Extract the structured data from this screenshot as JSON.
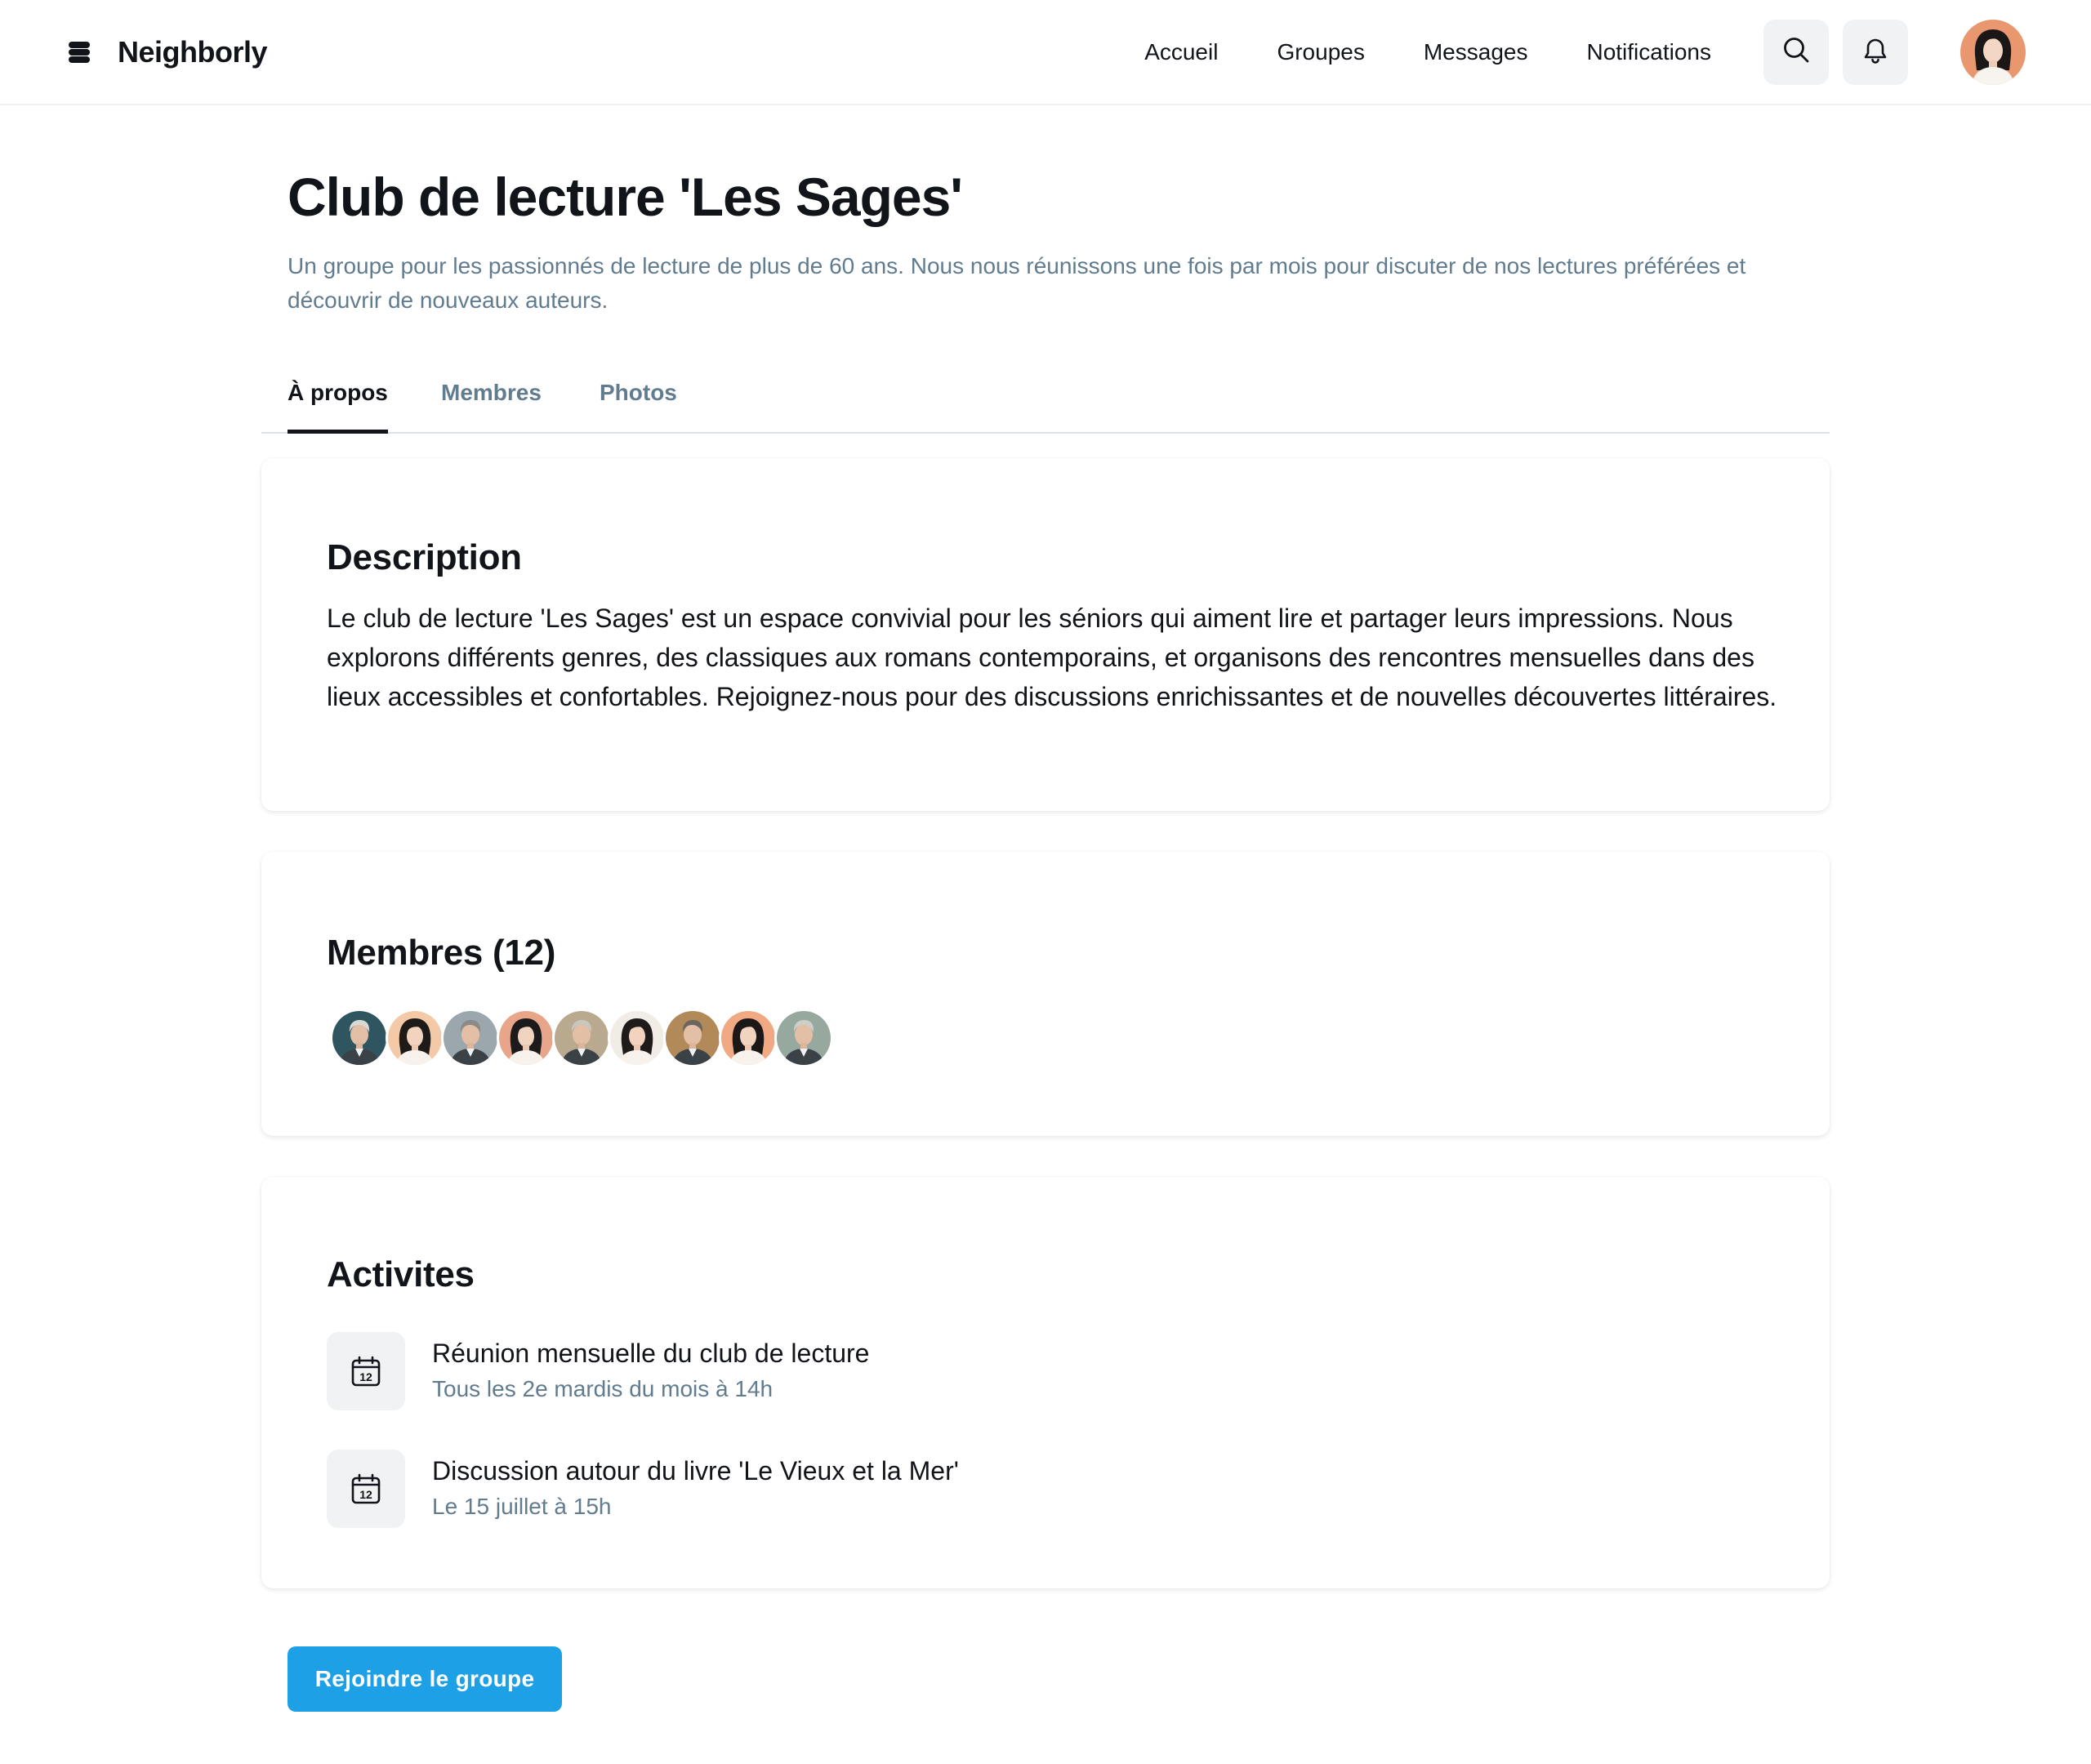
{
  "header": {
    "brand_name": "Neighborly",
    "brand_icon": "stack-logo-icon",
    "nav": [
      "Accueil",
      "Groupes",
      "Messages",
      "Notifications"
    ],
    "icons": [
      "search-icon",
      "bell-icon"
    ]
  },
  "group": {
    "title": "Club de lecture 'Les Sages'",
    "subtitle": "Un groupe pour les passionnés de lecture de plus de 60 ans. Nous nous réunissons une fois par mois pour discuter de nos lectures préférées et découvrir de nouveaux auteurs."
  },
  "tabs": [
    {
      "label": "À propos",
      "active": true
    },
    {
      "label": "Membres",
      "active": false
    },
    {
      "label": "Photos",
      "active": false
    }
  ],
  "description": {
    "title": "Description",
    "text": "Le club de lecture 'Les Sages' est un espace convivial pour les séniors qui aiment lire et partager leurs impressions. Nous explorons différents genres, des classiques aux romans contemporains, et organisons des rencontres mensuelles dans des lieux accessibles et confortables. Rejoignez-nous pour des discussions enrichissantes et de nouvelles découvertes littéraires."
  },
  "members": {
    "title": "Membres (12)",
    "avatars": [
      {
        "kind": "man",
        "bg": "#2f5560",
        "hair": "#d9d9d6"
      },
      {
        "kind": "woman",
        "bg": "#f3c9a8",
        "hair": "#1e1a18"
      },
      {
        "kind": "man",
        "bg": "#9ba7ad",
        "hair": "#8a8b88"
      },
      {
        "kind": "woman",
        "bg": "#e7a68a",
        "hair": "#1c1a1a"
      },
      {
        "kind": "man",
        "bg": "#b9a98f",
        "hair": "#c9c6bf"
      },
      {
        "kind": "woman",
        "bg": "#f1ece6",
        "hair": "#1f1b1a"
      },
      {
        "kind": "man",
        "bg": "#b28958",
        "hair": "#6c6660"
      },
      {
        "kind": "woman",
        "bg": "#f0a982",
        "hair": "#1c1817"
      },
      {
        "kind": "man",
        "bg": "#97a89f",
        "hair": "#cdcdc9"
      }
    ]
  },
  "activities": {
    "title": "Activites",
    "items": [
      {
        "icon": "calendar-icon",
        "day": "12",
        "title": "Réunion mensuelle du club de lecture",
        "subtitle": "Tous les 2e mardis du mois à 14h"
      },
      {
        "icon": "calendar-icon",
        "day": "12",
        "title": "Discussion autour du livre 'Le Vieux et la Mer'",
        "subtitle": "Le 15 juillet à 15h"
      }
    ]
  },
  "actions": {
    "join_label": "Rejoindre le groupe"
  },
  "colors": {
    "accent": "#1ea0e6",
    "muted_text": "#617b8f",
    "icon_bg": "#f0f2f4"
  }
}
